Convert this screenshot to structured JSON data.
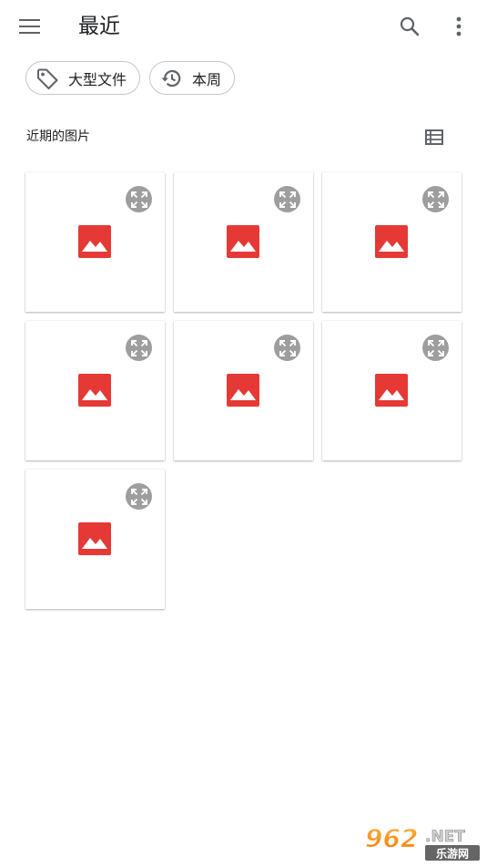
{
  "app_bar": {
    "title": "最近",
    "menu_icon": "menu-icon",
    "search_icon": "search-icon",
    "more_icon": "more-vert-icon"
  },
  "filters": [
    {
      "label": "大型文件",
      "icon": "label-tag-icon"
    },
    {
      "label": "本周",
      "icon": "history-icon"
    }
  ],
  "section": {
    "title": "近期的图片",
    "view_toggle_icon": "list-view-icon"
  },
  "images": [
    {
      "icon": "image-icon"
    },
    {
      "icon": "image-icon"
    },
    {
      "icon": "image-icon"
    },
    {
      "icon": "image-icon"
    },
    {
      "icon": "image-icon"
    },
    {
      "icon": "image-icon"
    },
    {
      "icon": "image-icon"
    }
  ],
  "watermark": {
    "number": "962",
    "domain": ".NET",
    "site_name": "乐游网"
  },
  "colors": {
    "image_icon": "#e53935",
    "expand_badge": "#9e9e9e",
    "chip_border": "#c7c7c7",
    "text": "#202124"
  }
}
